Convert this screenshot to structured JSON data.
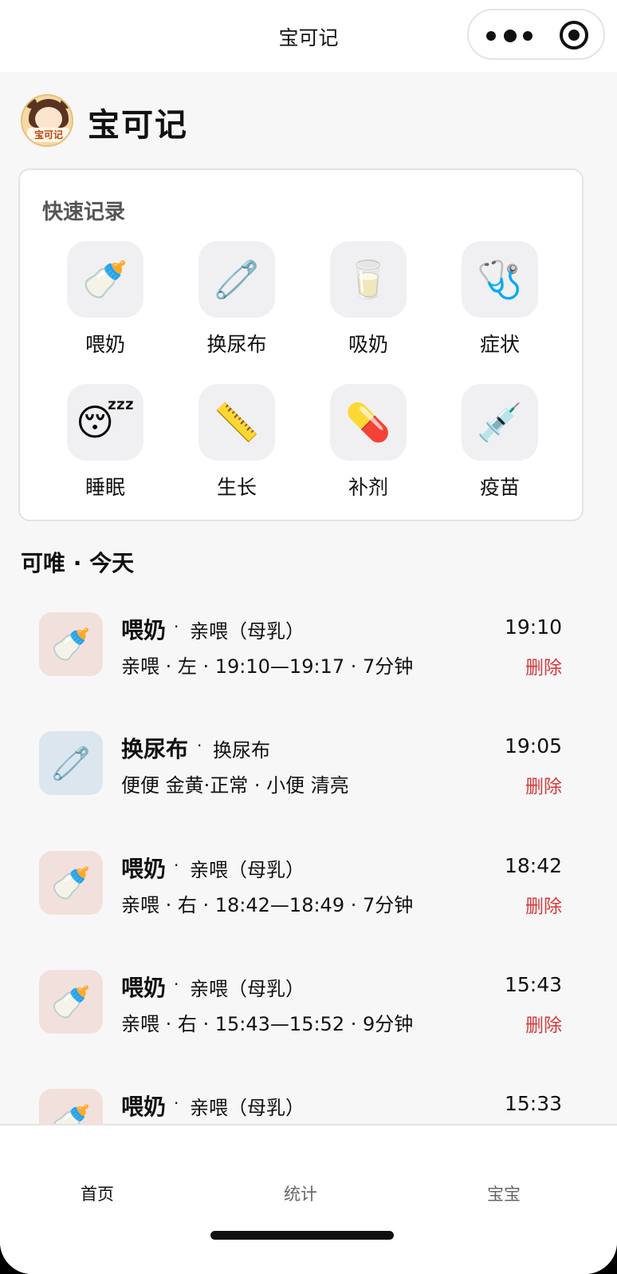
{
  "navbar": {
    "title": "宝可记"
  },
  "header": {
    "logo_text": "宝可记",
    "app_name": "宝可记"
  },
  "quick_record": {
    "title": "快速记录",
    "items": [
      {
        "label": "喂奶",
        "icon": "baby-bottle-icon",
        "glyph": "🍼"
      },
      {
        "label": "换尿布",
        "icon": "safety-pin-icon",
        "glyph": "🧷"
      },
      {
        "label": "吸奶",
        "icon": "milk-glass-icon",
        "glyph": "🥛"
      },
      {
        "label": "症状",
        "icon": "stethoscope-icon",
        "glyph": "🩺"
      },
      {
        "label": "睡眠",
        "icon": "sleeping-face-icon",
        "glyph": "😴"
      },
      {
        "label": "生长",
        "icon": "ruler-icon",
        "glyph": "📏"
      },
      {
        "label": "补剂",
        "icon": "pill-icon",
        "glyph": "💊"
      },
      {
        "label": "疫苗",
        "icon": "syringe-icon",
        "glyph": "💉"
      }
    ]
  },
  "section": {
    "title": "可唯 · 今天"
  },
  "records": [
    {
      "title": "喂奶",
      "sub": "亲喂（母乳）",
      "detail": "亲喂 · 左 · 19:10—19:17 · 7分钟",
      "time": "19:10",
      "delete": "删除",
      "icon": "baby-bottle-icon",
      "glyph": "🍼",
      "tile_color": "#f2e0dc"
    },
    {
      "title": "换尿布",
      "sub": "换尿布",
      "detail": "便便 金黄·正常 · 小便 清亮",
      "time": "19:05",
      "delete": "删除",
      "icon": "safety-pin-icon",
      "glyph": "🧷",
      "tile_color": "#dce6ee"
    },
    {
      "title": "喂奶",
      "sub": "亲喂（母乳）",
      "detail": "亲喂 · 右 · 18:42—18:49 · 7分钟",
      "time": "18:42",
      "delete": "删除",
      "icon": "baby-bottle-icon",
      "glyph": "🍼",
      "tile_color": "#f2e0dc"
    },
    {
      "title": "喂奶",
      "sub": "亲喂（母乳）",
      "detail": "亲喂 · 右 · 15:43—15:52 · 9分钟",
      "time": "15:43",
      "delete": "删除",
      "icon": "baby-bottle-icon",
      "glyph": "🍼",
      "tile_color": "#f2e0dc"
    },
    {
      "title": "喂奶",
      "sub": "亲喂（母乳）",
      "detail": "",
      "time": "15:33",
      "delete": "",
      "icon": "baby-bottle-icon",
      "glyph": "🍼",
      "tile_color": "#f2e0dc"
    }
  ],
  "tabbar": {
    "tabs": [
      {
        "label": "首页",
        "active": true
      },
      {
        "label": "统计",
        "active": false
      },
      {
        "label": "宝宝",
        "active": false
      }
    ],
    "active_color": "#111111",
    "inactive_color": "#666666"
  }
}
